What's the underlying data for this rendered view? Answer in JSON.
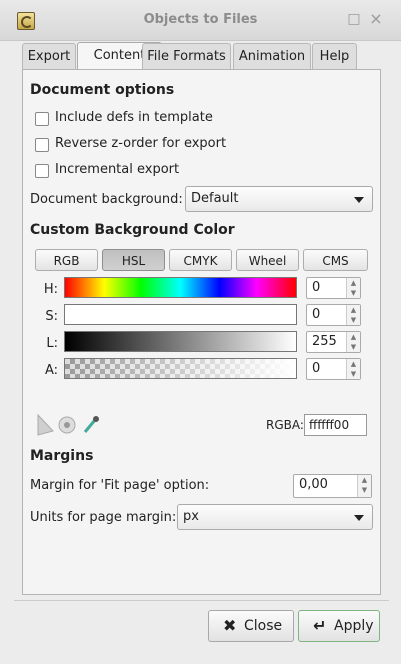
{
  "window": {
    "title": "Objects to Files"
  },
  "tabs": [
    "Export",
    "Content",
    "File Formats",
    "Animation",
    "Help"
  ],
  "document_options": {
    "heading": "Document options",
    "checkboxes": [
      "Include defs in template",
      "Reverse z-order for export",
      "Incremental export"
    ],
    "background_label": "Document background:",
    "background_value": "Default"
  },
  "custom_bg": {
    "heading": "Custom Background Color",
    "modes": [
      "RGB",
      "HSL",
      "CMYK",
      "Wheel",
      "CMS"
    ],
    "active_mode": "HSL",
    "sliders": [
      {
        "label": "H:",
        "value": "0"
      },
      {
        "label": "S:",
        "value": "0"
      },
      {
        "label": "L:",
        "value": "255"
      },
      {
        "label": "A:",
        "value": "0"
      }
    ],
    "rgba_label": "RGBA:",
    "rgba_value": "ffffff00"
  },
  "margins": {
    "heading": "Margins",
    "fit_label": "Margin for 'Fit page' option:",
    "fit_value": "0,00",
    "units_label": "Units for page margin:",
    "units_value": "px"
  },
  "buttons": {
    "close": "Close",
    "apply": "Apply"
  }
}
